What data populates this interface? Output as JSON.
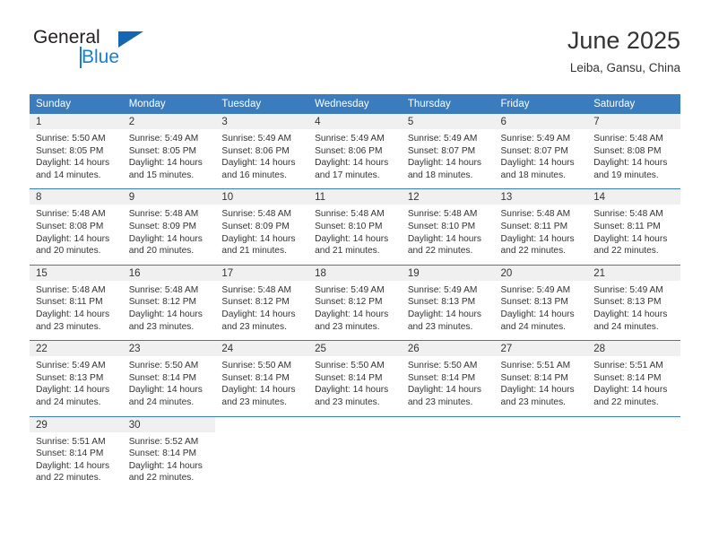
{
  "logo": {
    "primary_text": "General",
    "secondary_text": "Blue",
    "primary_color": "#231f20",
    "secondary_color": "#1a7fd4",
    "triangle_color": "#1565b0"
  },
  "header": {
    "title": "June 2025",
    "subtitle": "Leiba, Gansu, China"
  },
  "theme": {
    "header_bg": "#3a7cbe",
    "header_text": "#ffffff",
    "daynum_bg": "#f0f0f0",
    "body_text": "#333333",
    "row_divider": "#3a7cbe"
  },
  "weekday_headers": [
    "Sunday",
    "Monday",
    "Tuesday",
    "Wednesday",
    "Thursday",
    "Friday",
    "Saturday"
  ],
  "labels": {
    "sunrise_prefix": "Sunrise: ",
    "sunset_prefix": "Sunset: ",
    "daylight_prefix": "Daylight: "
  },
  "weeks": [
    [
      {
        "day": "1",
        "sunrise": "Sunrise: 5:50 AM",
        "sunset": "Sunset: 8:05 PM",
        "daylight": "Daylight: 14 hours and 14 minutes."
      },
      {
        "day": "2",
        "sunrise": "Sunrise: 5:49 AM",
        "sunset": "Sunset: 8:05 PM",
        "daylight": "Daylight: 14 hours and 15 minutes."
      },
      {
        "day": "3",
        "sunrise": "Sunrise: 5:49 AM",
        "sunset": "Sunset: 8:06 PM",
        "daylight": "Daylight: 14 hours and 16 minutes."
      },
      {
        "day": "4",
        "sunrise": "Sunrise: 5:49 AM",
        "sunset": "Sunset: 8:06 PM",
        "daylight": "Daylight: 14 hours and 17 minutes."
      },
      {
        "day": "5",
        "sunrise": "Sunrise: 5:49 AM",
        "sunset": "Sunset: 8:07 PM",
        "daylight": "Daylight: 14 hours and 18 minutes."
      },
      {
        "day": "6",
        "sunrise": "Sunrise: 5:49 AM",
        "sunset": "Sunset: 8:07 PM",
        "daylight": "Daylight: 14 hours and 18 minutes."
      },
      {
        "day": "7",
        "sunrise": "Sunrise: 5:48 AM",
        "sunset": "Sunset: 8:08 PM",
        "daylight": "Daylight: 14 hours and 19 minutes."
      }
    ],
    [
      {
        "day": "8",
        "sunrise": "Sunrise: 5:48 AM",
        "sunset": "Sunset: 8:08 PM",
        "daylight": "Daylight: 14 hours and 20 minutes."
      },
      {
        "day": "9",
        "sunrise": "Sunrise: 5:48 AM",
        "sunset": "Sunset: 8:09 PM",
        "daylight": "Daylight: 14 hours and 20 minutes."
      },
      {
        "day": "10",
        "sunrise": "Sunrise: 5:48 AM",
        "sunset": "Sunset: 8:09 PM",
        "daylight": "Daylight: 14 hours and 21 minutes."
      },
      {
        "day": "11",
        "sunrise": "Sunrise: 5:48 AM",
        "sunset": "Sunset: 8:10 PM",
        "daylight": "Daylight: 14 hours and 21 minutes."
      },
      {
        "day": "12",
        "sunrise": "Sunrise: 5:48 AM",
        "sunset": "Sunset: 8:10 PM",
        "daylight": "Daylight: 14 hours and 22 minutes."
      },
      {
        "day": "13",
        "sunrise": "Sunrise: 5:48 AM",
        "sunset": "Sunset: 8:11 PM",
        "daylight": "Daylight: 14 hours and 22 minutes."
      },
      {
        "day": "14",
        "sunrise": "Sunrise: 5:48 AM",
        "sunset": "Sunset: 8:11 PM",
        "daylight": "Daylight: 14 hours and 22 minutes."
      }
    ],
    [
      {
        "day": "15",
        "sunrise": "Sunrise: 5:48 AM",
        "sunset": "Sunset: 8:11 PM",
        "daylight": "Daylight: 14 hours and 23 minutes."
      },
      {
        "day": "16",
        "sunrise": "Sunrise: 5:48 AM",
        "sunset": "Sunset: 8:12 PM",
        "daylight": "Daylight: 14 hours and 23 minutes."
      },
      {
        "day": "17",
        "sunrise": "Sunrise: 5:48 AM",
        "sunset": "Sunset: 8:12 PM",
        "daylight": "Daylight: 14 hours and 23 minutes."
      },
      {
        "day": "18",
        "sunrise": "Sunrise: 5:49 AM",
        "sunset": "Sunset: 8:12 PM",
        "daylight": "Daylight: 14 hours and 23 minutes."
      },
      {
        "day": "19",
        "sunrise": "Sunrise: 5:49 AM",
        "sunset": "Sunset: 8:13 PM",
        "daylight": "Daylight: 14 hours and 23 minutes."
      },
      {
        "day": "20",
        "sunrise": "Sunrise: 5:49 AM",
        "sunset": "Sunset: 8:13 PM",
        "daylight": "Daylight: 14 hours and 24 minutes."
      },
      {
        "day": "21",
        "sunrise": "Sunrise: 5:49 AM",
        "sunset": "Sunset: 8:13 PM",
        "daylight": "Daylight: 14 hours and 24 minutes."
      }
    ],
    [
      {
        "day": "22",
        "sunrise": "Sunrise: 5:49 AM",
        "sunset": "Sunset: 8:13 PM",
        "daylight": "Daylight: 14 hours and 24 minutes."
      },
      {
        "day": "23",
        "sunrise": "Sunrise: 5:50 AM",
        "sunset": "Sunset: 8:14 PM",
        "daylight": "Daylight: 14 hours and 24 minutes."
      },
      {
        "day": "24",
        "sunrise": "Sunrise: 5:50 AM",
        "sunset": "Sunset: 8:14 PM",
        "daylight": "Daylight: 14 hours and 23 minutes."
      },
      {
        "day": "25",
        "sunrise": "Sunrise: 5:50 AM",
        "sunset": "Sunset: 8:14 PM",
        "daylight": "Daylight: 14 hours and 23 minutes."
      },
      {
        "day": "26",
        "sunrise": "Sunrise: 5:50 AM",
        "sunset": "Sunset: 8:14 PM",
        "daylight": "Daylight: 14 hours and 23 minutes."
      },
      {
        "day": "27",
        "sunrise": "Sunrise: 5:51 AM",
        "sunset": "Sunset: 8:14 PM",
        "daylight": "Daylight: 14 hours and 23 minutes."
      },
      {
        "day": "28",
        "sunrise": "Sunrise: 5:51 AM",
        "sunset": "Sunset: 8:14 PM",
        "daylight": "Daylight: 14 hours and 22 minutes."
      }
    ],
    [
      {
        "day": "29",
        "sunrise": "Sunrise: 5:51 AM",
        "sunset": "Sunset: 8:14 PM",
        "daylight": "Daylight: 14 hours and 22 minutes."
      },
      {
        "day": "30",
        "sunrise": "Sunrise: 5:52 AM",
        "sunset": "Sunset: 8:14 PM",
        "daylight": "Daylight: 14 hours and 22 minutes."
      },
      {
        "day": "",
        "sunrise": "",
        "sunset": "",
        "daylight": ""
      },
      {
        "day": "",
        "sunrise": "",
        "sunset": "",
        "daylight": ""
      },
      {
        "day": "",
        "sunrise": "",
        "sunset": "",
        "daylight": ""
      },
      {
        "day": "",
        "sunrise": "",
        "sunset": "",
        "daylight": ""
      },
      {
        "day": "",
        "sunrise": "",
        "sunset": "",
        "daylight": ""
      }
    ]
  ]
}
